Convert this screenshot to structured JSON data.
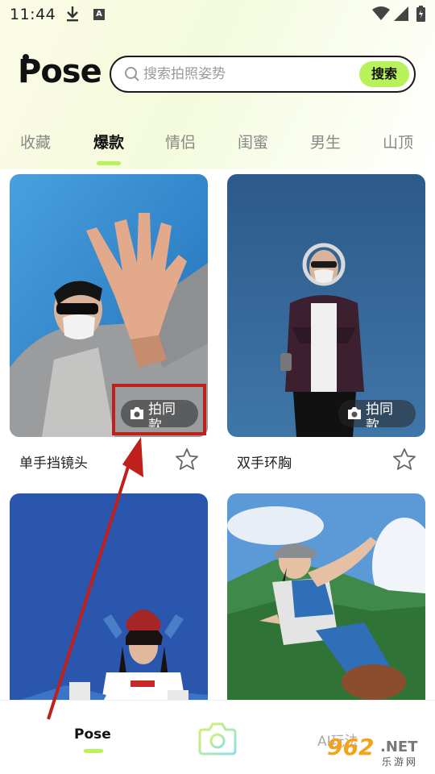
{
  "status_bar": {
    "time": "11:44",
    "a_badge": "A"
  },
  "header": {
    "logo": "Pose",
    "search": {
      "placeholder": "搜索拍照姿势",
      "button_label": "搜索"
    }
  },
  "tabs": [
    {
      "label": "收藏",
      "active": false
    },
    {
      "label": "爆款",
      "active": true
    },
    {
      "label": "情侣",
      "active": false
    },
    {
      "label": "闺蜜",
      "active": false
    },
    {
      "label": "男生",
      "active": false
    },
    {
      "label": "山顶",
      "active": false
    }
  ],
  "cards": [
    {
      "title": "单手挡镜头",
      "same_button": "拍同款",
      "favorited": false
    },
    {
      "title": "双手环胸",
      "same_button": "拍同款",
      "favorited": false
    },
    {
      "title": "",
      "same_button": ""
    },
    {
      "title": "",
      "same_button": ""
    }
  ],
  "bottom_nav": {
    "pose_label": "Pose",
    "ai_label": "AI玩法"
  },
  "watermark": {
    "number": "962",
    "net": ".NET",
    "cn": "乐游网"
  },
  "colors": {
    "accent": "#b8f25a",
    "annotation": "#c0201c"
  }
}
